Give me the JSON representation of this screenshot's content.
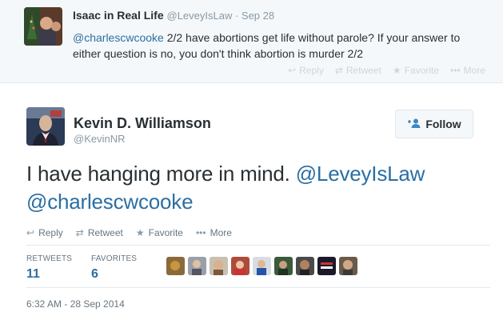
{
  "context_tweet": {
    "name": "Isaac in Real Life",
    "meta": "@LeveyIsLaw · Sep 28",
    "mention": "@charlescwcooke",
    "text": " 2/2 have abortions get life without parole?  If your answer to either question is no, you don't think abortion is murder 2/2",
    "actions": {
      "reply": "Reply",
      "retweet": "Retweet",
      "favorite": "Favorite",
      "more": "More"
    }
  },
  "main_tweet": {
    "name": "Kevin D. Williamson",
    "handle": "@KevinNR",
    "follow_label": "Follow",
    "text": "I have hanging more in mind. ",
    "mention1": "@LeveyIsLaw",
    "mention2": "@charlescwcooke",
    "actions": {
      "reply": "Reply",
      "retweet": "Retweet",
      "favorite": "Favorite",
      "more": "More"
    },
    "stats": {
      "retweets_label": "RETWEETS",
      "retweets": "11",
      "favorites_label": "FAVORITES",
      "favorites": "6"
    },
    "timestamp": "6:32 AM - 28 Sep 2014"
  },
  "colors": {
    "link": "#2a6fa3",
    "meta": "#8899a6",
    "context_bg": "#f5f8fa",
    "border": "#e1e8ed"
  },
  "icons": [
    "reply-icon",
    "retweet-icon",
    "favorite-icon",
    "more-icon",
    "follow-person-icon"
  ]
}
